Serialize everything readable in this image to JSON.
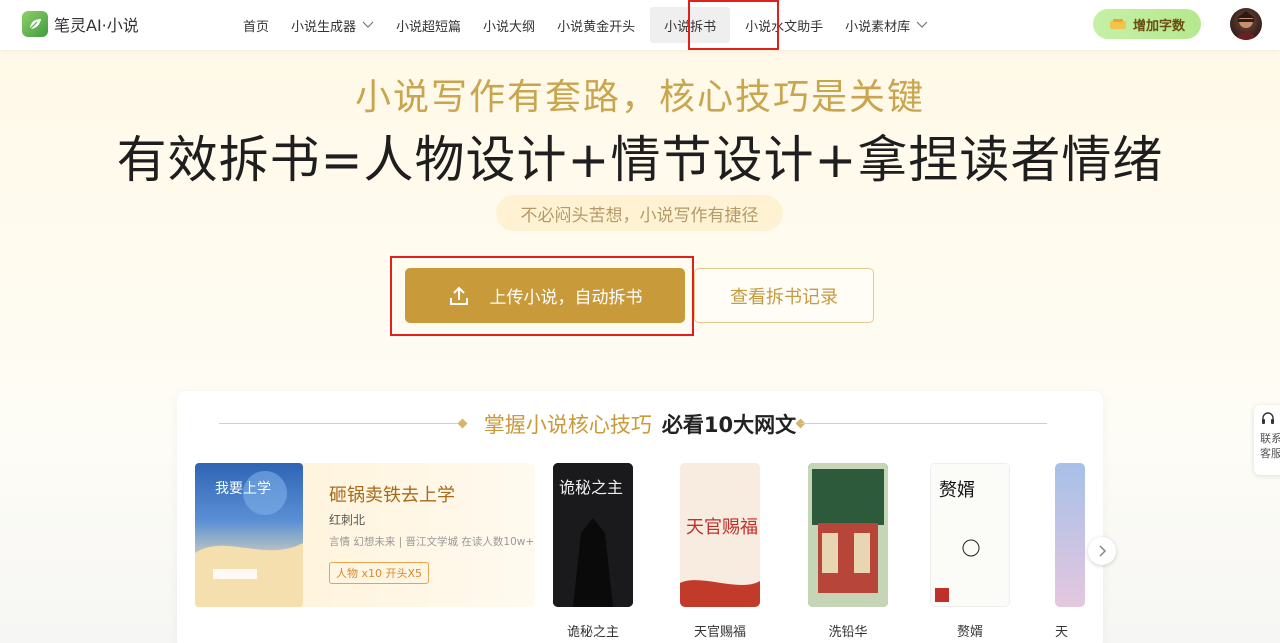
{
  "app": {
    "logo_text": "笔灵AI·小说"
  },
  "nav": {
    "items": [
      {
        "label": "首页"
      },
      {
        "label": "小说生成器"
      },
      {
        "label": "小说超短篇"
      },
      {
        "label": "小说大纲"
      },
      {
        "label": "小说黄金开头"
      },
      {
        "label": "小说拆书"
      },
      {
        "label": "小说水文助手"
      },
      {
        "label": "小说素材库"
      }
    ],
    "active": "小说拆书"
  },
  "header": {
    "add_words_label": "增加字数"
  },
  "hero": {
    "subtitle": "小说写作有套路，核心技巧是关键",
    "title": "有效拆书=人物设计+情节设计+拿捏读者情绪",
    "pill": "不必闷头苦想，小说写作有捷径",
    "upload_label": "上传小说，自动拆书",
    "history_label": "查看拆书记录"
  },
  "card": {
    "title_a": "掌握小说核心技巧",
    "title_b": "必看10大网文",
    "featured": {
      "title": "砸锅卖铁去上学",
      "author": "红刺北",
      "meta": "言情  幻想未来 | 晋江文学城  在读人数10w+",
      "tag": "人物 x10  开头X5",
      "cover_text": "我要上学"
    },
    "books": [
      {
        "name": "诡秘之主",
        "cover_text": "诡秘之主"
      },
      {
        "name": "天官赐福",
        "cover_text": "天官赐福"
      },
      {
        "name": "洗铅华",
        "cover_text": ""
      },
      {
        "name": "赘婿",
        "cover_text": "赘婿"
      },
      {
        "name": "天",
        "cover_text": ""
      }
    ]
  },
  "side": {
    "cs_label": "联系客服"
  }
}
